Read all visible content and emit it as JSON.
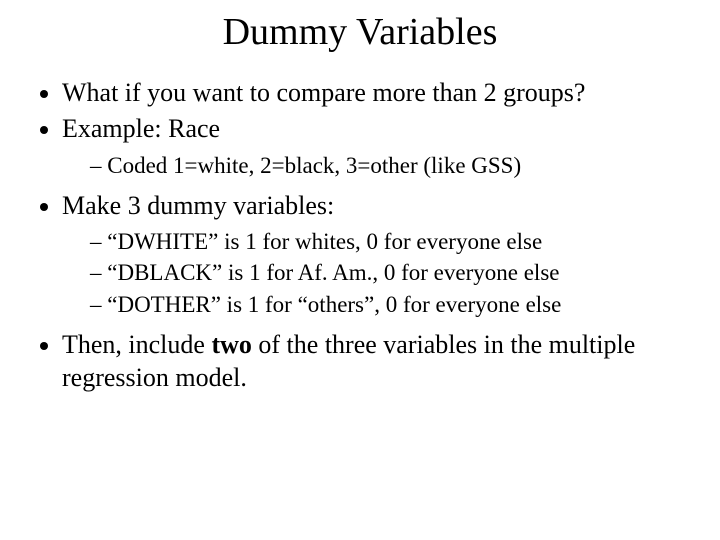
{
  "title": "Dummy Variables",
  "b1": "What if you want to compare more than 2 groups?",
  "b2": "Example:  Race",
  "b2s1": "Coded 1=white, 2=black, 3=other (like GSS)",
  "b3": "Make 3 dummy variables:",
  "b3s1": "“DWHITE” is 1 for whites, 0 for everyone else",
  "b3s2": "“DBLACK” is 1 for Af. Am., 0 for everyone else",
  "b3s3": "“DOTHER” is 1 for “others”, 0 for everyone else",
  "b4a": "Then, include ",
  "b4b": "two",
  "b4c": " of the three variables in the multiple regression model."
}
